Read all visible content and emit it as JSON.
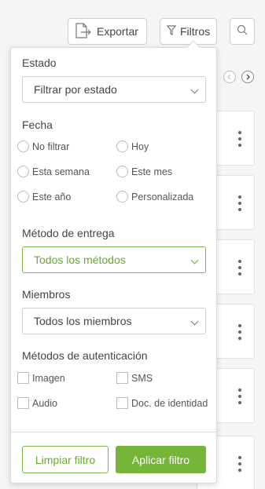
{
  "toolbar": {
    "export_label": "Exportar",
    "filter_label": "Filtros"
  },
  "filters": {
    "estado": {
      "label": "Estado",
      "placeholder": "Filtrar por estado"
    },
    "fecha": {
      "label": "Fecha",
      "options": [
        "No filtrar",
        "Hoy",
        "Esta semana",
        "Este mes",
        "Este año",
        "Personalizada"
      ]
    },
    "metodo_entrega": {
      "label": "Método de entrega",
      "value": "Todos los métodos"
    },
    "miembros": {
      "label": "Miembros",
      "value": "Todos los miembros"
    },
    "autenticacion": {
      "label": "Métodos de autenticación",
      "options": [
        "Imagen",
        "SMS",
        "Audio",
        "Doc. de identidad"
      ]
    }
  },
  "actions": {
    "clear_label": "Limpiar filtro",
    "apply_label": "Aplicar filtro"
  },
  "colors": {
    "accent": "#77b53a"
  }
}
